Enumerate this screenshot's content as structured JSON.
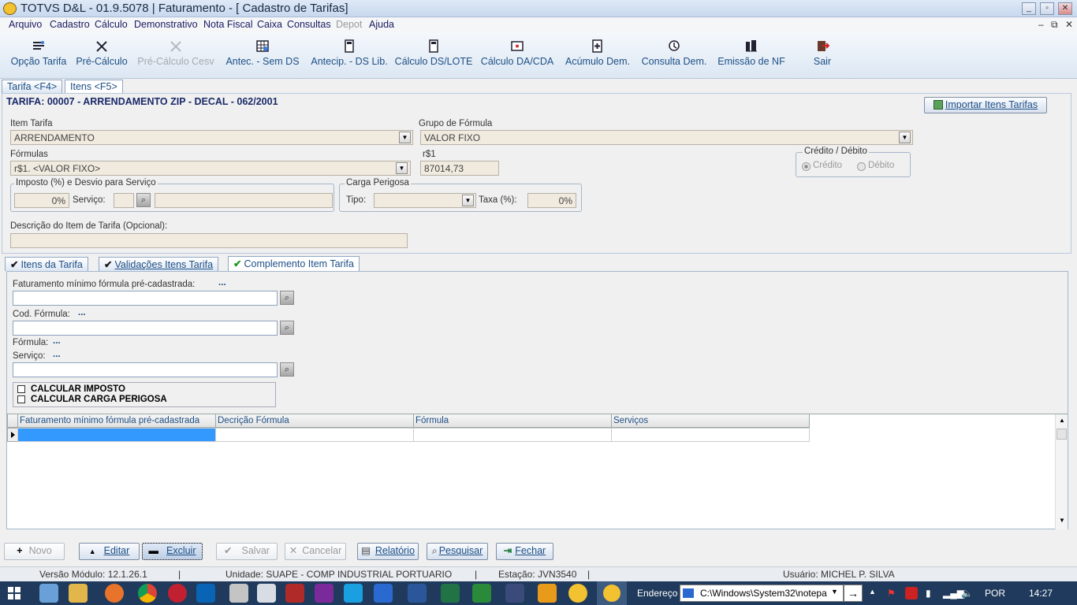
{
  "window": {
    "title": "TOTVS D&L - 01.9.5078 | Faturamento - [ Cadastro de Tarifas]",
    "min_label": "_",
    "max_label": "▫",
    "close_label": "✕"
  },
  "menu": [
    "Arquivo",
    "Cadastro",
    "Cálculo",
    "Demonstrativo",
    "Nota Fiscal",
    "Caixa",
    "Consultas",
    "Depot",
    "Ajuda"
  ],
  "toolbar": [
    "Opção Tarifa",
    "Pré-Cálculo",
    "Pré-Cálculo Cesv",
    "Antec. - Sem DS",
    "Antecip. - DS Lib.",
    "Cálculo DS/LOTE",
    "Cálculo DA/CDA",
    "Acúmulo Dem.",
    "Consulta Dem.",
    "Emissão de NF",
    "Sair"
  ],
  "tabs": [
    "Tarifa <F4>",
    "Itens <F5>"
  ],
  "header": {
    "tarifa": "TARIFA: 00007 - ARRENDAMENTO ZIP - DECAL - 062/2001",
    "import_button": "Importar Itens Tarifas"
  },
  "form": {
    "item_tarifa_label": "Item Tarifa",
    "item_tarifa_value": "ARRENDAMENTO",
    "grupo_label": "Grupo de Fórmula",
    "grupo_value": "VALOR FIXO",
    "formulas_label": "Fórmulas",
    "formulas_value": "r$1. <VALOR FIXO>",
    "r1_label": "r$1",
    "r1_value": "87014,73",
    "credito_debito_label": "Crédito / Débito",
    "credito_label": "Crédito",
    "debito_label": "Débito",
    "imposto_group_label": "Imposto (%) e Desvio para Serviço",
    "imposto_value": "0%",
    "servico_label": "Serviço:",
    "carga_group_label": "Carga Perigosa",
    "tipo_label": "Tipo:",
    "taxa_label": "Taxa (%):",
    "taxa_value": "0%",
    "descricao_label": "Descrição do Item de Tarifa (Opcional):"
  },
  "subtabs": [
    "Itens da Tarifa",
    "Validações Itens Tarifa",
    "Complemento Item Tarifa"
  ],
  "complement": {
    "fat_min_label": "Faturamento mínimo fórmula pré-cadastrada:",
    "fat_min_dots": "...",
    "cod_formula_label": "Cod. Fórmula:",
    "cod_formula_dots": "...",
    "formula_label": "Fórmula:",
    "formula_dots": "...",
    "servico_label": "Serviço:",
    "servico_dots": "...",
    "calc_imposto": "CALCULAR IMPOSTO",
    "calc_carga": "CALCULAR CARGA PERIGOSA"
  },
  "grid": {
    "columns": [
      "Faturamento mínimo fórmula pré-cadastrada",
      "Decrição Fórmula",
      "Fórmula",
      "Serviços"
    ]
  },
  "buttons": {
    "novo": "Novo",
    "editar": "Editar",
    "excluir": "Excluir",
    "salvar": "Salvar",
    "cancelar": "Cancelar",
    "relatorio": "Relatório",
    "pesquisar": "Pesquisar",
    "fechar": "Fechar"
  },
  "status": {
    "versao": "Versão Módulo:  12.1.26.1",
    "unidade": "Unidade: SUAPE - COMP INDUSTRIAL PORTUARIO",
    "estacao": "Estação: JVN3540",
    "usuario": "Usuário: MICHEL P. SILVA",
    "sep": "|"
  },
  "taskbar": {
    "endereco_label": "Endereço",
    "address": "C:\\Windows\\System32\\notepa",
    "lang": "POR",
    "time": "14:27"
  },
  "colors": {
    "accent": "#1d4f86",
    "title": "#1a2a40",
    "selection": "#3399ff",
    "taskbar": "#1f3a5c"
  }
}
